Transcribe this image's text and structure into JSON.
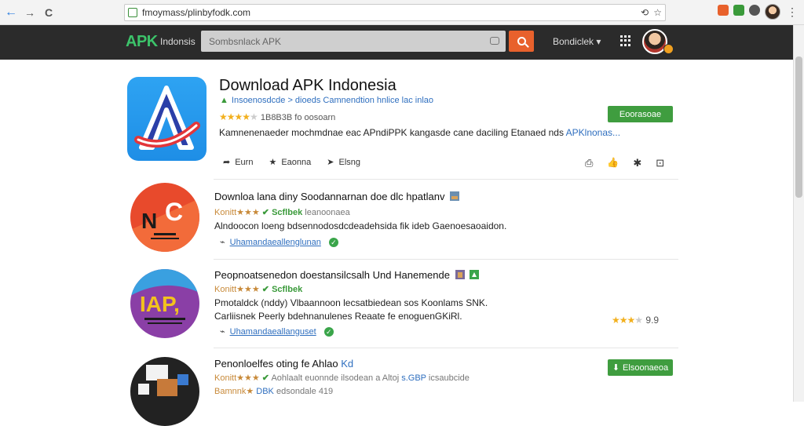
{
  "browser": {
    "url": "fmoymass/plinbyfodk.com",
    "nav_back": "←",
    "nav_forward": "→",
    "nav_reload": "C",
    "colors": {
      "ext1": "#e8612c",
      "ext2": "#3a9a3a",
      "ext3": "#555555"
    }
  },
  "header": {
    "logo": "APK",
    "logo_sub": "Indonsis",
    "search_placeholder": "Sombsnlack APK",
    "menu_label": "Bondiclek",
    "accent": "#e8612c"
  },
  "hero": {
    "title": "Download APK Indonesia",
    "breadcrumb": "Insoenosdcde > dioeds Camnendtion hnlice lac inlao",
    "rating_count": "1B8B3B fo oosoarn",
    "rating_stars": 4,
    "description": "Kamnenenaeder mochmdnae eac APndiPPK kangasde cane daciling Etanaed nds",
    "description_link": "APKlnonas...",
    "install_label": "Eoorasoae",
    "actions": [
      {
        "icon": "share-icon",
        "glyph": "➦",
        "label": "Eurn"
      },
      {
        "icon": "star-icon",
        "glyph": "★",
        "label": "Eaonna"
      },
      {
        "icon": "forward-icon",
        "glyph": "➤",
        "label": "Elsng"
      }
    ],
    "right_icons": [
      {
        "icon": "bookmark-icon",
        "glyph": "⎙"
      },
      {
        "icon": "thumbs-up-icon",
        "glyph": "👍"
      },
      {
        "icon": "pin-icon",
        "glyph": "✱"
      },
      {
        "icon": "more-icon",
        "glyph": "⊡"
      }
    ]
  },
  "items": [
    {
      "title": "Downloa lana diny Soodannarnan doe dlc hpatlanv",
      "meta_rating": "Konitt★★★",
      "meta_verify": "Scflbek",
      "meta_extra": "leanoonaea",
      "description": "Alndoocon loeng bdsennodosdcdeadehsida fik ideb Gaenoesaoaidon.",
      "link": "Uhamandaeallenglunan",
      "icon_text": "N C",
      "icon_bg": "#e84a2c"
    },
    {
      "title": "Peopnoatsenedon doestansilcsalh Und Hanemende",
      "meta_rating": "Konitt★★★",
      "meta_verify": "Scflbek",
      "meta_extra": "",
      "description": "Pmotaldck (nddy) Vlbaannoon lecsatbiedean sos Koonlams SNK.",
      "description2": "Carliisnek Peerly bdehnanulenes Reaate fe enoguenGKiRl.",
      "link": "Uhamandaeallanguset",
      "icon_text": "IAP,",
      "icon_bg": "#8a3fa6",
      "side_rating": "9.9",
      "side_stars": 3
    },
    {
      "title": "Penonloelfes oting fe Ahlao",
      "title_tag": "Kd",
      "meta_rating": "Konitt★★★",
      "meta_verify": "Aohlaalt",
      "meta_extra": "euonnde ilsodean a Altoj",
      "meta_link": "s.GBP",
      "meta_extra2": "icsaubcide",
      "meta2_rating": "Bamnnk★",
      "meta2_link": "DBK",
      "meta2_text": "edsondale",
      "meta2_num": "419",
      "install_label": "Elsoonaeoa",
      "icon_bg": "#222222"
    }
  ]
}
